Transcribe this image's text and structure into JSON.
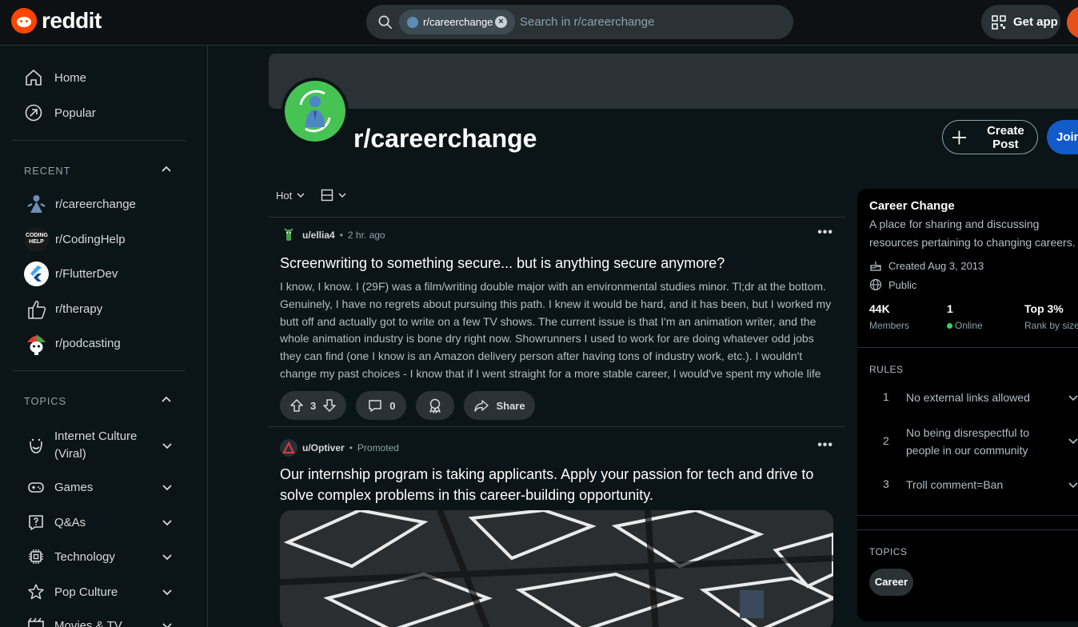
{
  "header": {
    "logo_text": "reddit",
    "search_chip": "r/careerchange",
    "search_placeholder": "Search in r/careerchange",
    "get_app": "Get app"
  },
  "sidebar": {
    "nav": [
      {
        "label": "Home",
        "icon": "home-icon"
      },
      {
        "label": "Popular",
        "icon": "popular-icon"
      }
    ],
    "recent_title": "RECENT",
    "recent": [
      {
        "label": "r/careerchange"
      },
      {
        "label": "r/CodingHelp",
        "icon_text": "CODING HELP"
      },
      {
        "label": "r/FlutterDev"
      },
      {
        "label": "r/therapy"
      },
      {
        "label": "r/podcasting"
      }
    ],
    "topics_title": "TOPICS",
    "topics": [
      {
        "label": "Internet Culture",
        "label2": "(Viral)",
        "icon": "smile-icon"
      },
      {
        "label": "Games",
        "icon": "gamepad-icon"
      },
      {
        "label": "Q&As",
        "icon": "question-icon"
      },
      {
        "label": "Technology",
        "icon": "chip-icon"
      },
      {
        "label": "Pop Culture",
        "icon": "star-icon"
      },
      {
        "label": "Movies & TV",
        "icon": "film-icon"
      }
    ]
  },
  "subreddit": {
    "name": "r/careerchange",
    "create_post": "Create Post",
    "join": "Join",
    "sort": "Hot"
  },
  "posts": [
    {
      "author": "u/ellia4",
      "time": "2 hr. ago",
      "title": "Screenwriting to something secure... but is anything secure anymore?",
      "body": "I know, I know. I (29F) was a film/writing double major with an environmental studies minor. Tl;dr at the bottom. Genuinely, I have no regrets about pursuing this path. I knew it would be hard, and it has been, but I worked my butt off and actually got to write on a few TV shows. The current issue is that I'm an animation writer, and the whole animation industry is bone dry right now. Showrunners I used to work for are doing whatever odd jobs they can find (one I know is an Amazon delivery person after having tons of industry work, etc.). I wouldn't change my past choices - I know that if I went straight for a more stable career, I would've spent my whole life regretting not trying to pursu...",
      "votes": "3",
      "comments": "0",
      "share": "Share"
    },
    {
      "author": "u/Optiver",
      "time": "Promoted",
      "title": "Our internship program is taking applicants. Apply your passion for tech and drive to solve complex problems in this career-building opportunity."
    }
  ],
  "about": {
    "title": "Career Change",
    "description": "A place for sharing and discussing resources pertaining to changing careers.",
    "created": "Created Aug 3, 2013",
    "visibility": "Public",
    "stats": [
      {
        "value": "44K",
        "label": "Members"
      },
      {
        "value": "1",
        "label": "Online"
      },
      {
        "value": "Top 3%",
        "label": "Rank by size"
      }
    ],
    "rules_title": "RULES",
    "rules": [
      {
        "num": "1",
        "text": "No external links allowed"
      },
      {
        "num": "2",
        "text": "No being disrespectful to people in our community"
      },
      {
        "num": "3",
        "text": "Troll comment=Ban"
      }
    ],
    "topics_title": "TOPICS",
    "topics": [
      "Career"
    ]
  },
  "colors": {
    "brand": "#ff4500",
    "join": "#115bca",
    "online": "#2bd563",
    "background": "#0b1416"
  }
}
